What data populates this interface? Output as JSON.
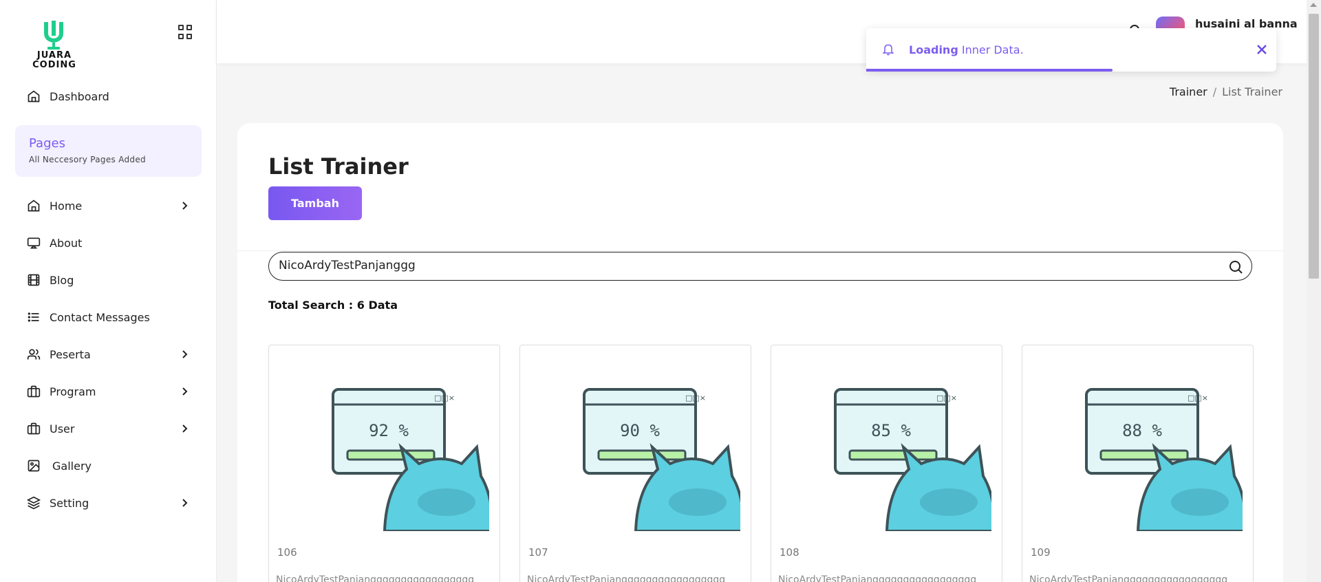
{
  "brand": {
    "line1": "JUARA",
    "line2": "CODING"
  },
  "sidebar": {
    "dashboard": "Dashboard",
    "pages_card": {
      "title": "Pages",
      "subtitle": "All Neccesory Pages Added"
    },
    "items": [
      {
        "label": "Home",
        "icon": "home-icon",
        "has_submenu": true
      },
      {
        "label": "About",
        "icon": "monitor-icon",
        "has_submenu": false
      },
      {
        "label": "Blog",
        "icon": "film-icon",
        "has_submenu": false
      },
      {
        "label": "Contact Messages",
        "icon": "list-icon",
        "has_submenu": false
      },
      {
        "label": "Peserta",
        "icon": "users-icon",
        "has_submenu": true
      },
      {
        "label": "Program",
        "icon": "briefcase-icon",
        "has_submenu": true
      },
      {
        "label": "User",
        "icon": "briefcase-icon",
        "has_submenu": true
      },
      {
        "label": "Gallery",
        "icon": "image-icon",
        "has_submenu": false
      },
      {
        "label": "Setting",
        "icon": "layers-icon",
        "has_submenu": true
      }
    ]
  },
  "header": {
    "user_name": "husaini al banna"
  },
  "toast": {
    "strong": "Loading",
    "text": " Inner Data.",
    "progress": 0.6
  },
  "breadcrumb": {
    "parent": "Trainer",
    "separator": "/",
    "current": "List Trainer"
  },
  "main": {
    "title": "List Trainer",
    "add_button": "Tambah",
    "search_value": "NicoArdyTestPanjanggg",
    "total_label": "Total Search : 6 Data",
    "tiles": [
      {
        "id": "106",
        "percent": "92 %",
        "name": "NicoArdyTestPanjanggggggggggggggggg"
      },
      {
        "id": "107",
        "percent": "90 %",
        "name": "NicoArdyTestPanjanggggggggggggggggg"
      },
      {
        "id": "108",
        "percent": "85 %",
        "name": "NicoArdyTestPanjanggggggggggggggggg"
      },
      {
        "id": "109",
        "percent": "88 %",
        "name": "NicoArdyTestPanjanggggggggggggggggg"
      }
    ]
  },
  "colors": {
    "accent": "#7c5cf0",
    "accent_light": "#f3f0ff",
    "logo_green": "#1fce8c",
    "tile_cat": "#5ccfe0"
  }
}
